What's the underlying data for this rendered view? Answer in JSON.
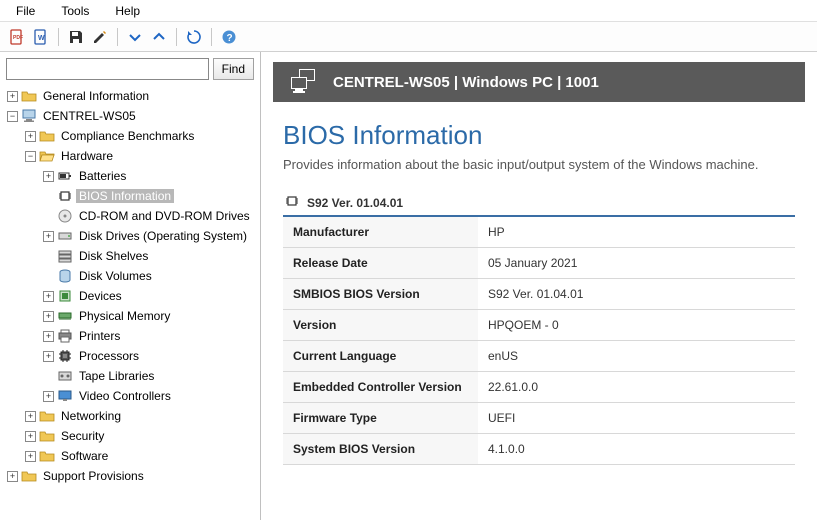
{
  "menubar": [
    "File",
    "Tools",
    "Help"
  ],
  "toolbar": {
    "icons": [
      "pdf-icon",
      "word-icon",
      "save-icon",
      "edit-icon",
      "expand-icon",
      "collapse-icon",
      "refresh-icon",
      "help-icon"
    ]
  },
  "search": {
    "placeholder": "",
    "value": "",
    "button": "Find"
  },
  "tree": [
    {
      "depth": 0,
      "expand": "+",
      "icon": "folder",
      "label": "General Information"
    },
    {
      "depth": 0,
      "expand": "-",
      "icon": "computer",
      "label": "CENTREL-WS05"
    },
    {
      "depth": 1,
      "expand": "+",
      "icon": "folder",
      "label": "Compliance Benchmarks"
    },
    {
      "depth": 1,
      "expand": "-",
      "icon": "folder-open",
      "label": "Hardware"
    },
    {
      "depth": 2,
      "expand": "+",
      "icon": "battery",
      "label": "Batteries"
    },
    {
      "depth": 2,
      "expand": "",
      "icon": "chip",
      "label": "BIOS Information",
      "selected": true
    },
    {
      "depth": 2,
      "expand": "",
      "icon": "disc",
      "label": "CD-ROM and DVD-ROM Drives"
    },
    {
      "depth": 2,
      "expand": "+",
      "icon": "drive",
      "label": "Disk Drives (Operating System)"
    },
    {
      "depth": 2,
      "expand": "",
      "icon": "shelves",
      "label": "Disk Shelves"
    },
    {
      "depth": 2,
      "expand": "",
      "icon": "volume",
      "label": "Disk Volumes"
    },
    {
      "depth": 2,
      "expand": "+",
      "icon": "device",
      "label": "Devices"
    },
    {
      "depth": 2,
      "expand": "+",
      "icon": "memory",
      "label": "Physical Memory"
    },
    {
      "depth": 2,
      "expand": "+",
      "icon": "printer",
      "label": "Printers"
    },
    {
      "depth": 2,
      "expand": "+",
      "icon": "cpu",
      "label": "Processors"
    },
    {
      "depth": 2,
      "expand": "",
      "icon": "tape",
      "label": "Tape Libraries"
    },
    {
      "depth": 2,
      "expand": "+",
      "icon": "video",
      "label": "Video Controllers"
    },
    {
      "depth": 1,
      "expand": "+",
      "icon": "folder",
      "label": "Networking"
    },
    {
      "depth": 1,
      "expand": "+",
      "icon": "folder",
      "label": "Security"
    },
    {
      "depth": 1,
      "expand": "+",
      "icon": "folder",
      "label": "Software"
    },
    {
      "depth": 0,
      "expand": "+",
      "icon": "folder",
      "label": "Support Provisions"
    }
  ],
  "titlebar": {
    "text": "CENTREL-WS05 | Windows PC | 1001"
  },
  "page": {
    "heading": "BIOS Information",
    "subtitle": "Provides information about the basic input/output system of the Windows machine.",
    "section_title": "S92 Ver. 01.04.01",
    "props": [
      {
        "k": "Manufacturer",
        "v": "HP"
      },
      {
        "k": "Release Date",
        "v": "05 January 2021"
      },
      {
        "k": "SMBIOS BIOS Version",
        "v": "S92 Ver. 01.04.01"
      },
      {
        "k": "Version",
        "v": "HPQOEM - 0"
      },
      {
        "k": "Current Language",
        "v": "enUS"
      },
      {
        "k": "Embedded Controller Version",
        "v": "22.61.0.0"
      },
      {
        "k": "Firmware Type",
        "v": "UEFI"
      },
      {
        "k": "System BIOS Version",
        "v": "4.1.0.0"
      }
    ]
  },
  "colors": {
    "accent": "#2b6aa8",
    "border": "#3a6ea5",
    "titlebar": "#5a5a5a"
  }
}
